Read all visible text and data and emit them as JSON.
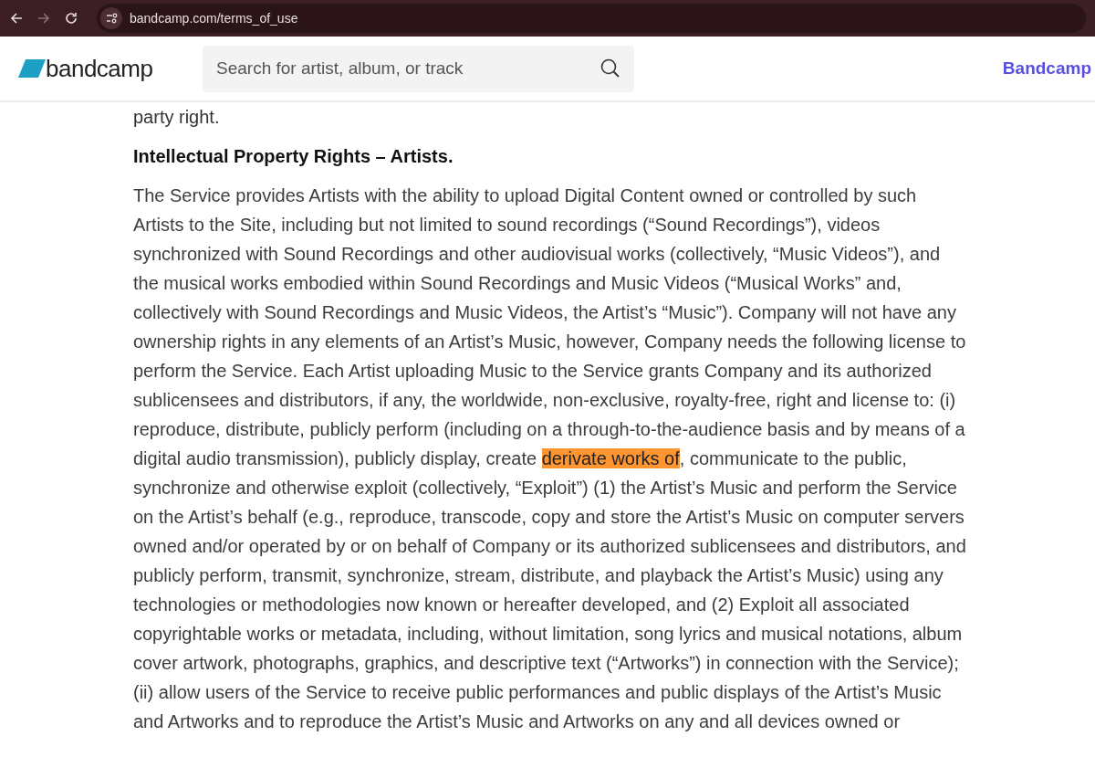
{
  "browser": {
    "url": "bandcamp.com/terms_of_use"
  },
  "header": {
    "logo": "bandcamp",
    "search": {
      "placeholder": "Search for artist, album, or track"
    },
    "link": "Bandcamp"
  },
  "content": {
    "previous_text": "party right.",
    "heading": "Intellectual Property Rights – Artists.",
    "paragraph_lines": [
      [
        {
          "text": "The Service provides Artists with the ability to upload Digital Content owned or controlled by such",
          "highlighted": false
        }
      ],
      [
        {
          "text": "Artists to the Site, including but not limited to sound recordings (“Sound Recordings”), videos",
          "highlighted": false
        }
      ],
      [
        {
          "text": "synchronized with Sound Recordings and other audiovisual works (collectively, “Music Videos”), and",
          "highlighted": false
        }
      ],
      [
        {
          "text": "the musical works embodied within Sound Recordings and Music Videos (“Musical Works” and,",
          "highlighted": false
        }
      ],
      [
        {
          "text": "collectively with Sound Recordings and Music Videos, the Artist’s “Music”). Company will not have any",
          "highlighted": false
        }
      ],
      [
        {
          "text": "ownership rights in any elements of an Artist’s Music, however, Company needs the following license to",
          "highlighted": false
        }
      ],
      [
        {
          "text": "perform the Service. Each Artist uploading Music to the Service grants Company and its authorized",
          "highlighted": false
        }
      ],
      [
        {
          "text": "sublicensees and distributors, if any, the worldwide, non-exclusive, royalty-free, right and license to: (i)",
          "highlighted": false
        }
      ],
      [
        {
          "text": "reproduce, distribute, publicly perform (including on a through-to-the-audience basis and by means of a",
          "highlighted": false
        }
      ],
      [
        {
          "text": "digital audio transmission), publicly display, create ",
          "highlighted": false
        },
        {
          "text": "derivate works of",
          "highlighted": true
        },
        {
          "text": ", communicate to the public,",
          "highlighted": false
        }
      ],
      [
        {
          "text": "synchronize and otherwise exploit (collectively, “Exploit”) (1) the Artist’s Music and perform the Service",
          "highlighted": false
        }
      ],
      [
        {
          "text": "on the Artist’s behalf (e.g., reproduce, transcode, copy and store the Artist’s Music on computer servers",
          "highlighted": false
        }
      ],
      [
        {
          "text": "owned and/or operated by or on behalf of Company or its authorized sublicensees and distributors, and",
          "highlighted": false
        }
      ],
      [
        {
          "text": "publicly perform, transmit, synchronize, stream, distribute, and playback the Artist’s Music) using any",
          "highlighted": false
        }
      ],
      [
        {
          "text": "technologies or methodologies now known or hereafter developed, and (2) Exploit all associated",
          "highlighted": false
        }
      ],
      [
        {
          "text": "copyrightable works or metadata, including, without limitation, song lyrics and musical notations, album",
          "highlighted": false
        }
      ],
      [
        {
          "text": "cover artwork, photographs, graphics, and descriptive text (“Artworks”) in connection with the Service);",
          "highlighted": false
        }
      ],
      [
        {
          "text": "(ii) allow users of the Service to receive public performances and public displays of the Artist’s Music",
          "highlighted": false
        }
      ],
      [
        {
          "text": "and Artworks and to reproduce the Artist’s Music and Artworks on any and all devices owned or",
          "highlighted": false
        }
      ]
    ]
  }
}
